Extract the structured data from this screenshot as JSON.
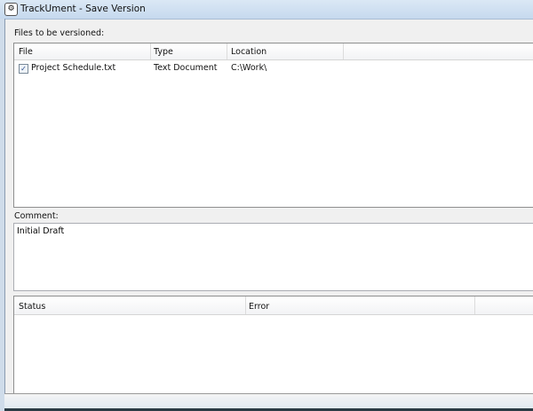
{
  "window": {
    "title": "TrackUment - Save Version",
    "icon": "app-icon"
  },
  "files": {
    "label": "Files to be versioned:",
    "columns": [
      "File",
      "Type",
      "Location"
    ],
    "rows": [
      {
        "checked": true,
        "file": "Project Schedule.txt",
        "type": "Text Document",
        "location": "C:\\Work\\"
      }
    ]
  },
  "comment": {
    "label": "Comment:",
    "value": "Initial Draft"
  },
  "status": {
    "columns": [
      "Status",
      "Error"
    ]
  }
}
